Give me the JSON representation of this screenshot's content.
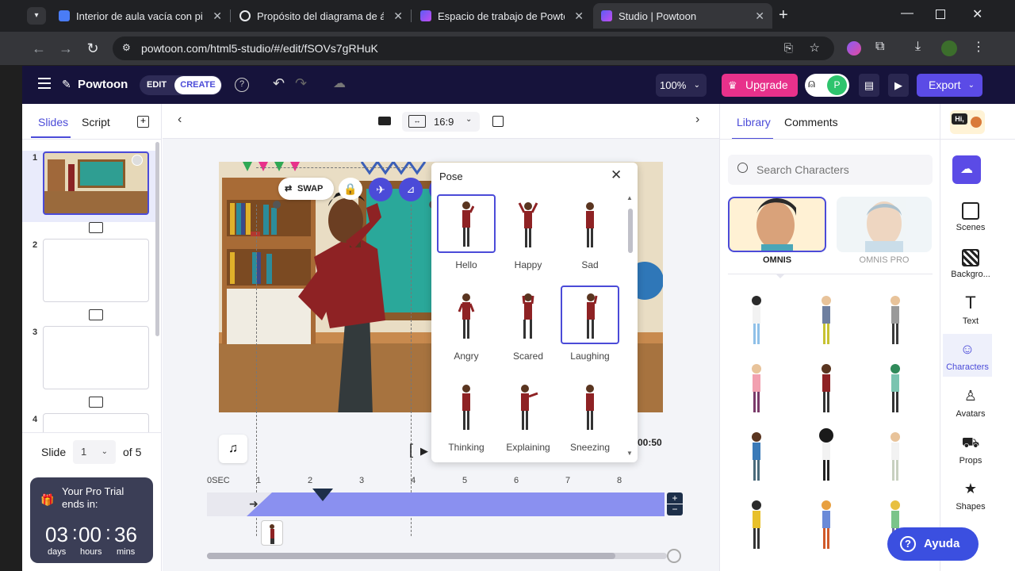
{
  "browser": {
    "tabs": [
      {
        "title": "Interior de aula vacía con pizarr",
        "favicon_color": "#4a7cf6"
      },
      {
        "title": "Propósito del diagrama de árbo",
        "favicon_color": "#e8eaed"
      },
      {
        "title": "Espacio de trabajo de Powtoon",
        "favicon_color": "#7b5cf5"
      },
      {
        "title": "Studio | Powtoon",
        "favicon_color": "#7b5cf5"
      }
    ],
    "url": "powtoon.com/html5-studio/#/edit/fSOVs7gRHuK"
  },
  "topbar": {
    "logo": "Powtoon",
    "edit": "EDIT",
    "create": "CREATE",
    "zoom": "100%",
    "upgrade": "Upgrade",
    "avatar_letter": "P",
    "export": "Export"
  },
  "left": {
    "tab_slides": "Slides",
    "tab_script": "Script",
    "slide_numbers": [
      "1",
      "2",
      "3",
      "4"
    ],
    "slide_label": "Slide",
    "slide_value": "1",
    "slide_of": "of 5",
    "trial_title": "Your Pro Trial ends in:",
    "days": "03",
    "hours": "00",
    "mins": "36",
    "days_label": "days",
    "hours_label": "hours",
    "mins_label": "mins"
  },
  "center": {
    "ratio": "16:9",
    "swap": "SWAP",
    "duration": "00:50",
    "timeline_ticks": [
      "0SEC",
      "1",
      "2",
      "3",
      "4",
      "5",
      "6",
      "7",
      "8"
    ]
  },
  "pose": {
    "title": "Pose",
    "items": [
      "Hello",
      "Happy",
      "Sad",
      "Angry",
      "Scared",
      "Laughing",
      "Thinking",
      "Explaining",
      "Sneezing"
    ]
  },
  "right": {
    "tab_library": "Library",
    "tab_comments": "Comments",
    "hi_badge": "Hi,",
    "search_placeholder": "Search Characters",
    "omnis": "OMNIS",
    "omnis_pro": "OMNIS PRO",
    "side_nav": [
      "Scenes",
      "Backgro...",
      "Text",
      "Characters",
      "Avatars",
      "Props",
      "Shapes"
    ],
    "help": "Ayuda"
  },
  "colors": {
    "accent": "#4b4bd8",
    "upgrade": "#e8318b",
    "export": "#5b4be6",
    "topbar": "#16133b",
    "timeline": "#8a90f0"
  }
}
